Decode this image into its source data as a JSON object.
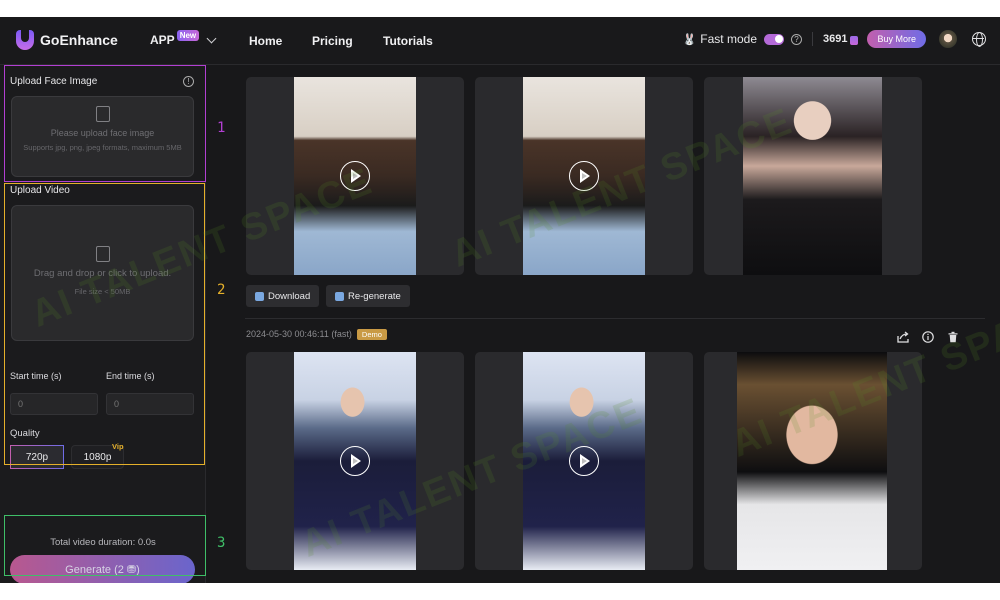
{
  "header": {
    "brand": "GoEnhance",
    "app_menu": "APP",
    "app_badge": "New",
    "nav": [
      "Home",
      "Pricing",
      "Tutorials"
    ],
    "fast_mode_label": "Fast mode",
    "fast_mode_on": true,
    "credits": "3691",
    "buy_more": "Buy More"
  },
  "sidebar": {
    "face_section": {
      "title": "Upload Face Image",
      "placeholder": "Please upload face image",
      "hint": "Supports jpg, png, jpeg formats, maximum 5MB"
    },
    "video_section": {
      "title": "Upload Video",
      "placeholder": "Drag and drop or click to upload.",
      "hint": "File size < 50MB"
    },
    "start_time_label": "Start time (s)",
    "end_time_label": "End time (s)",
    "start_time_placeholder": "0",
    "end_time_placeholder": "0",
    "quality_label": "Quality",
    "quality_options": [
      "720p",
      "1080p"
    ],
    "quality_selected": "720p",
    "vip_tag": "Vip",
    "duration_text": "Total video duration: 0.0s",
    "generate_label": "Generate (2 ⛃)"
  },
  "annotations": {
    "one": "1",
    "two": "2",
    "three": "3",
    "colors": {
      "one": "#b23fd2",
      "two": "#e5b02a",
      "three": "#3fbf68"
    }
  },
  "results": [
    {
      "timestamp": "",
      "items": [
        "source-video",
        "result-video",
        "face-image"
      ],
      "actions": [
        "Download",
        "Re-generate"
      ]
    },
    {
      "timestamp": "2024-05-30 00:46:11 (fast)",
      "badge": "Demo",
      "items": [
        "source-video",
        "result-video",
        "face-image"
      ],
      "tools": [
        "share-icon",
        "info-icon",
        "trash-icon"
      ]
    }
  ],
  "watermark": "AI TALENT SPACE",
  "colors": {
    "accent_gradient_start": "#c25fae",
    "accent_gradient_end": "#6f6ce6",
    "demo_badge": "#c99a45"
  }
}
